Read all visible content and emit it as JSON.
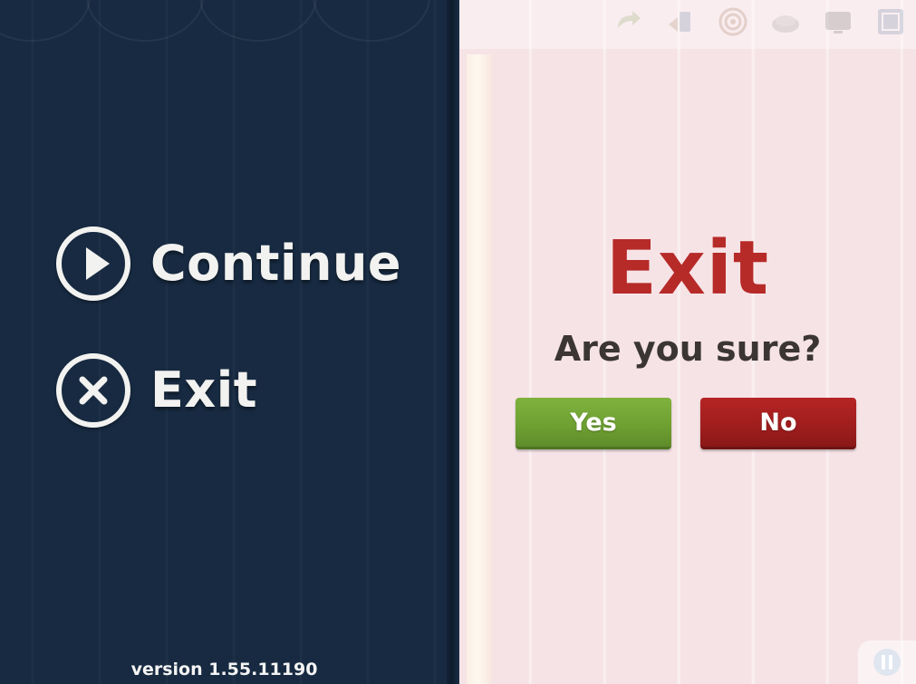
{
  "pause_menu": {
    "items": [
      {
        "label": "Continue",
        "icon": "play-icon"
      },
      {
        "label": "Exit",
        "icon": "close-icon"
      }
    ],
    "version": "version 1.55.11190"
  },
  "exit_dialog": {
    "title": "Exit",
    "question": "Are you sure?",
    "yes_label": "Yes",
    "no_label": "No"
  },
  "toolbar": {
    "icons": [
      "redo-icon",
      "hint-icon",
      "target-icon",
      "shop-icon",
      "tv-icon",
      "map-icon"
    ]
  },
  "hud": {
    "pause_icon": "pause-icon"
  },
  "colors": {
    "menu_background": "#172a41",
    "game_background": "#f6e3e6",
    "title_red": "#b62a28",
    "yes_green": "#6fa132",
    "no_red": "#a11e1e"
  }
}
